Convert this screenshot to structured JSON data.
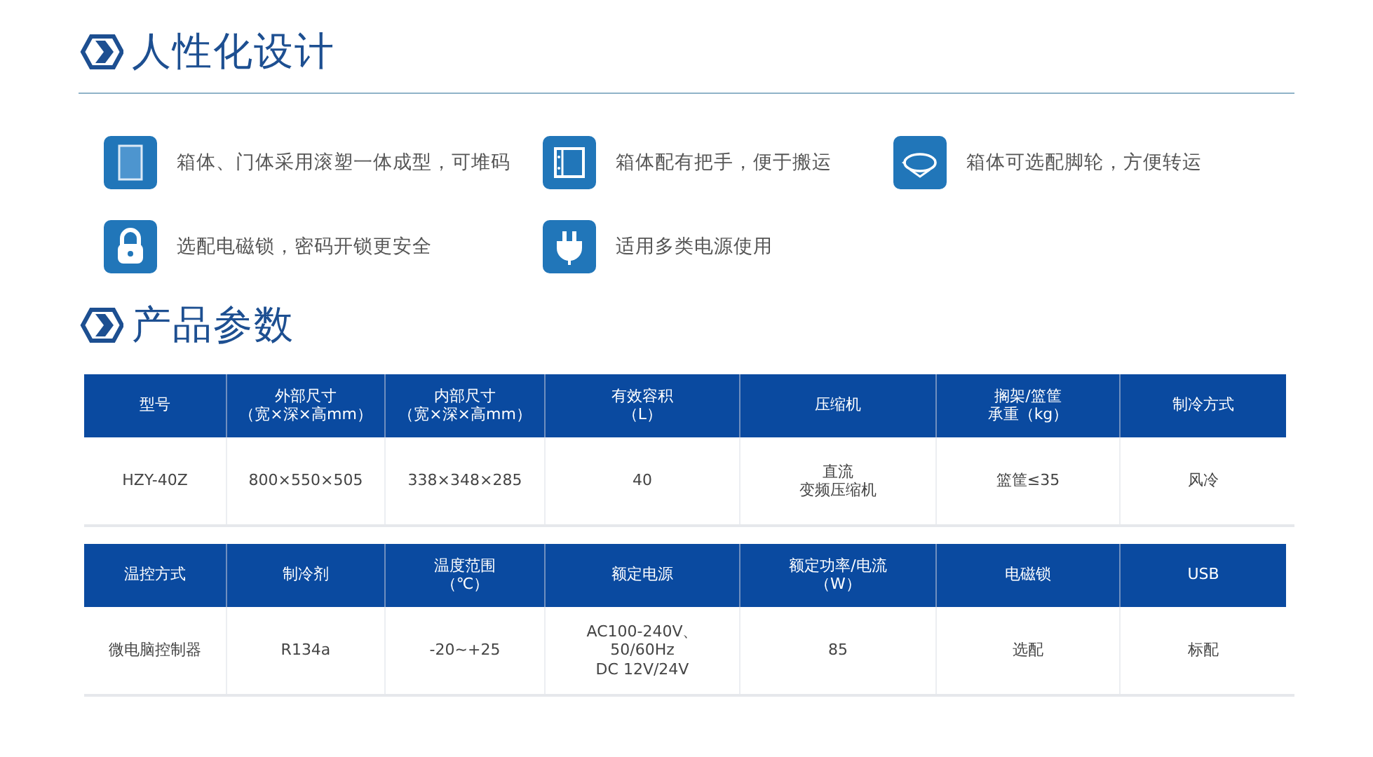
{
  "sections": [
    {
      "title": "人性化设计",
      "kind": "features",
      "features": [
        {
          "kind": "panel",
          "text": "箱体、门体采用滚塑一体成型，可堆码"
        },
        {
          "kind": "handle",
          "text": "箱体配有把手，便于搬运"
        },
        {
          "kind": "wheel",
          "text": "箱体可选配脚轮，方便转运"
        },
        {
          "kind": "lock",
          "text": "选配电磁锁，密码开锁更安全"
        },
        {
          "kind": "plug",
          "text": "适用多类电源使用"
        }
      ]
    },
    {
      "title": "产品参数",
      "kind": "tables",
      "tables": [
        {
          "columns": [
            "型号",
            [
              "外部尺寸",
              "（宽×深×高mm）"
            ],
            [
              "内部尺寸",
              "（宽×深×高mm）"
            ],
            [
              "有效容积",
              "（L）"
            ],
            "压缩机",
            [
              "搁架/篮筐",
              "承重（kg）"
            ],
            "制冷方式"
          ],
          "rows": [
            [
              "HZY-40Z",
              "800×550×505",
              "338×348×285",
              "40",
              [
                "直流",
                "变频压缩机"
              ],
              "篮筐≤35",
              "风冷"
            ]
          ]
        },
        {
          "columns": [
            "温控方式",
            "制冷剂",
            [
              "温度范围",
              "（℃）"
            ],
            "额定电源",
            [
              "额定功率/电流",
              "（W）"
            ],
            "电磁锁",
            "USB"
          ],
          "rows": [
            [
              "微电脑控制器",
              "R134a",
              "-20~+25",
              [
                "AC100-240V、",
                "50/60Hz",
                "DC 12V/24V"
              ],
              "85",
              "选配",
              "标配"
            ]
          ]
        }
      ]
    }
  ]
}
